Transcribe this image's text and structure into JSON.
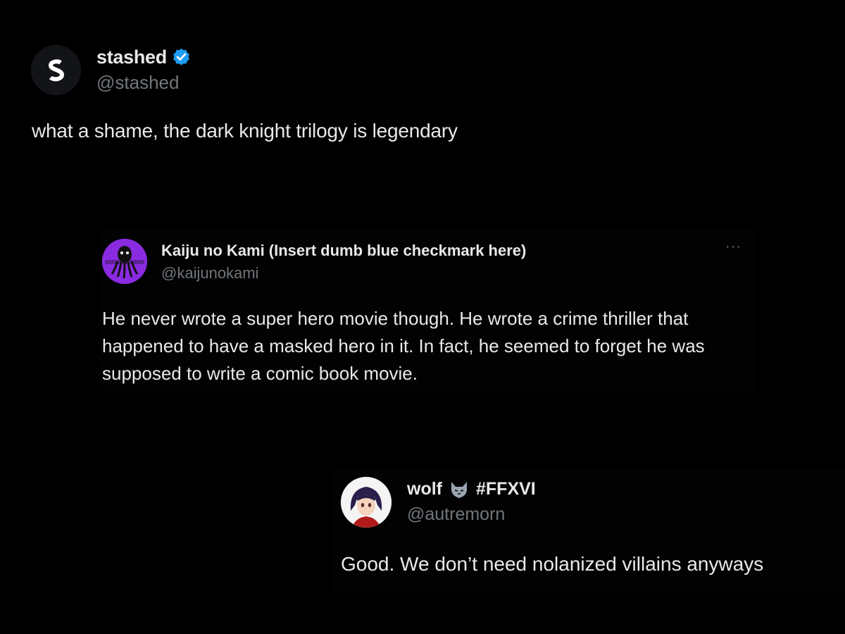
{
  "posts": [
    {
      "display_name": "stashed",
      "handle": "@stashed",
      "verified": true,
      "avatar_icon": "stashed-logo-icon",
      "text": "what a shame, the dark knight trilogy is legendary"
    },
    {
      "display_name": "Kaiju no Kami (Insert dumb blue checkmark here)",
      "handle": "@kaijunokami",
      "avatar_icon": "octopus-avatar-icon",
      "more_label": "···",
      "text": "He never wrote a super hero movie though.  He wrote a crime thriller that happened to have a masked hero in it.  In fact, he seemed to forget he was supposed to write a comic book movie."
    },
    {
      "display_name": "wolf",
      "name_suffix": "#FFXVI",
      "handle": "@autremorn",
      "avatar_icon": "anime-character-avatar-icon",
      "text": "Good. We don’t need nolanized villains anyways"
    }
  ],
  "colors": {
    "background": "#000000",
    "text_primary": "#e7e9ea",
    "text_secondary": "#71767b",
    "verified_blue": "#1d9bf0",
    "kaiju_avatar_purple": "#8a2be2"
  }
}
